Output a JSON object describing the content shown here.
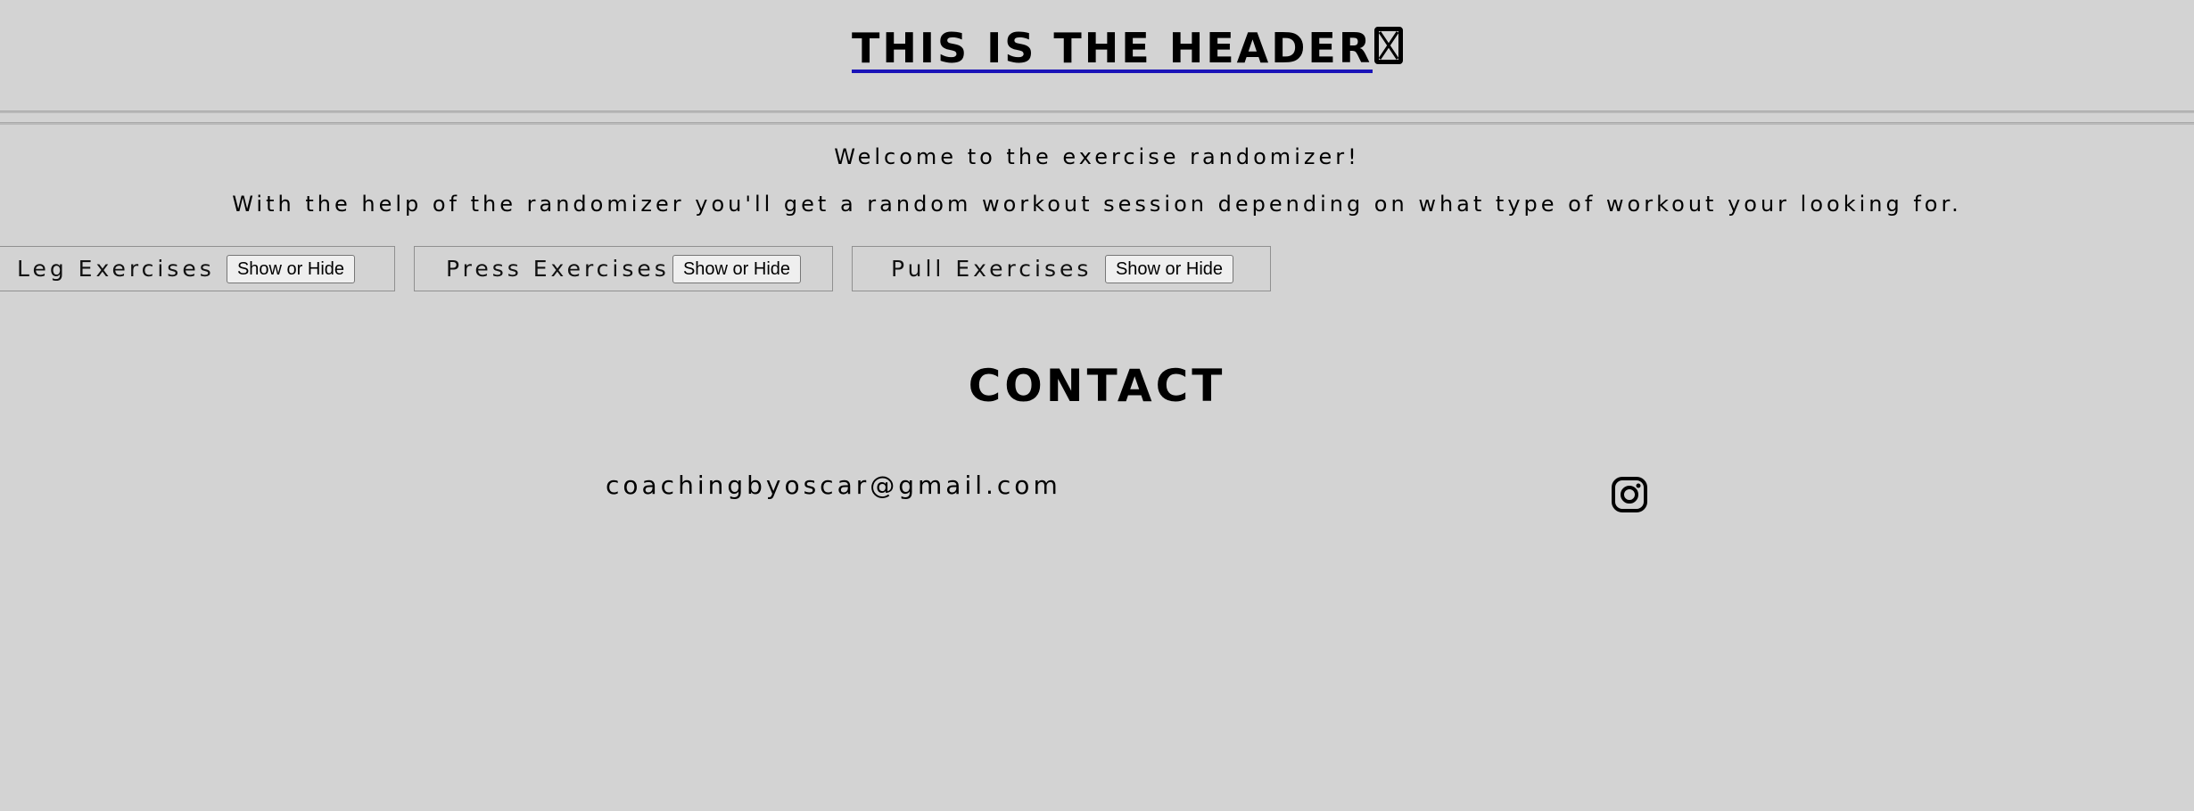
{
  "header": {
    "title": "THIS IS THE HEADER",
    "trailing_icon": "broken-glyph-icon",
    "link_underline_color": "#1a14b8"
  },
  "intro": {
    "welcome": "Welcome to the exercise randomizer!",
    "description": "With the help of the randomizer you'll get a random workout session depending on what type of workout your looking for."
  },
  "exercises": [
    {
      "label": "Leg Exercises",
      "button": "Show or Hide"
    },
    {
      "label": "Press Exercises",
      "button": "Show or Hide"
    },
    {
      "label": "Pull Exercises",
      "button": "Show or Hide"
    }
  ],
  "contact": {
    "title": "CONTACT",
    "email": "coachingbyoscar@gmail.com",
    "social_icon": "instagram-icon"
  },
  "colors": {
    "background": "#d3d3d3",
    "text": "#000000"
  }
}
